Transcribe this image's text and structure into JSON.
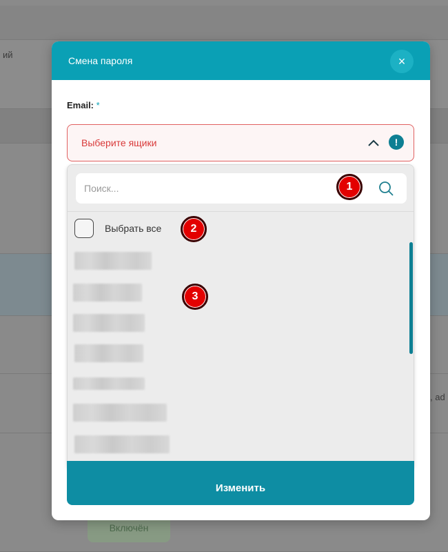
{
  "background": {
    "left_text": "ий",
    "right_text": ", ad",
    "status_badge": "Включён"
  },
  "modal": {
    "title": "Смена пароля",
    "close_glyph": "×",
    "field_label": "Email:",
    "required_mark": "*",
    "select_placeholder": "Выберите ящики",
    "alert_glyph": "!",
    "search_placeholder": "Поиск...",
    "select_all_label": "Выбрать все",
    "list_items_count_visible": 7,
    "submit_label": "Изменить"
  },
  "markers": [
    {
      "label": "1"
    },
    {
      "label": "2"
    },
    {
      "label": "3"
    }
  ],
  "colors": {
    "header_teal": "#0aa0b5",
    "button_teal": "#0e8da3",
    "error_red": "#d93a3a",
    "marker_red": "#e30000"
  },
  "icons": {
    "close": "close-icon",
    "chevron": "chevron-up-icon",
    "alert": "alert-icon",
    "search": "search-icon"
  }
}
